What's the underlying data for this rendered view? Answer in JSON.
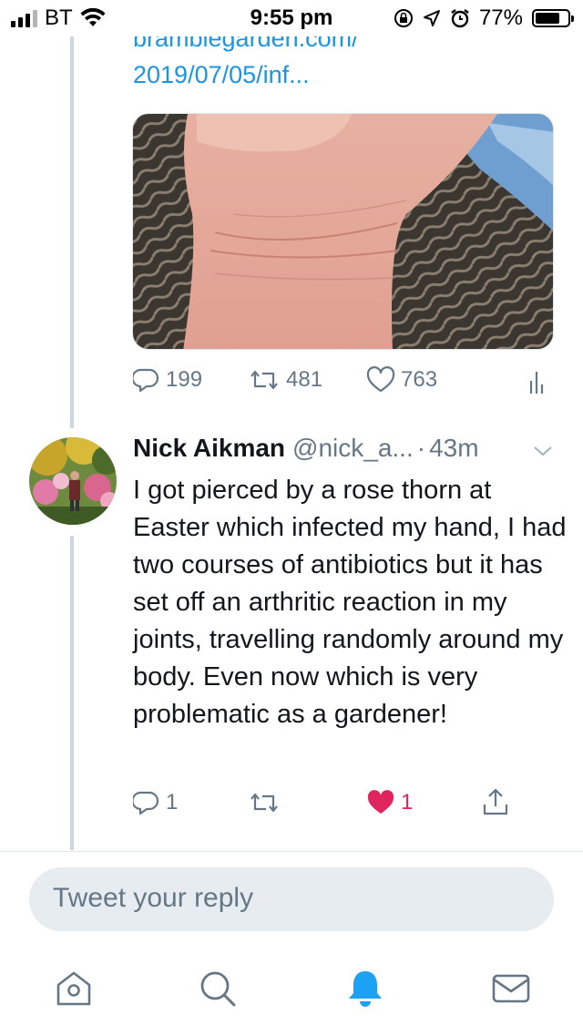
{
  "status_bar": {
    "carrier": "BT",
    "time": "9:55 pm",
    "battery": "77%",
    "battery_level": 0.77
  },
  "previous_tweet": {
    "link_line1": "bramblegarden.com/",
    "link_line2": "2019/07/05/inf...",
    "media_alt_icon": "photo-of-wrist",
    "replies": "199",
    "retweets": "481",
    "likes": "763"
  },
  "reply_tweet": {
    "name": "Nick Aikman",
    "handle": "@nick_a...",
    "separator": "·",
    "time": "43m",
    "text": "I got pierced by a rose thorn at Easter which infected my hand, I had two courses of antibiotics but it has set off an arthritic reaction in my joints, travelling randomly around my body. Even now which is very problematic as a gardener!",
    "replies": "1",
    "likes": "1",
    "liked": true
  },
  "reply_input": {
    "placeholder": "Tweet your reply"
  },
  "tabs": [
    "home-icon",
    "search-icon",
    "notifications-icon",
    "messages-icon"
  ],
  "colors": {
    "accent": "#1da1f2",
    "link": "#1b95e0",
    "like": "#e0245e",
    "muted": "#657786"
  }
}
